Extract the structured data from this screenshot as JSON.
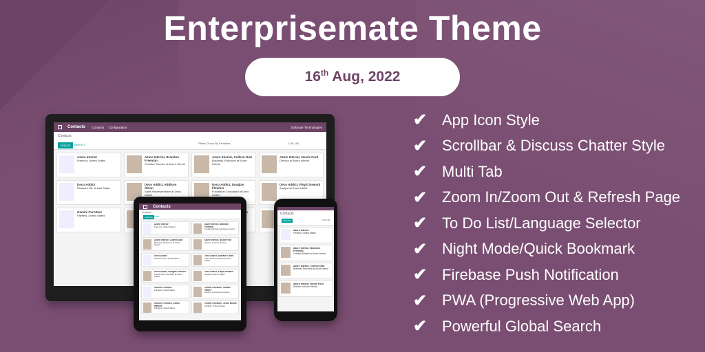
{
  "headline": "Enterprisemate Theme",
  "date": {
    "day": "16",
    "suffix": "th",
    "rest": " Aug, 2022"
  },
  "features": [
    "App Icon Style",
    "Scrollbar & Discuss Chatter Style",
    "Multi Tab",
    "Zoom In/Zoom Out & Refresh Page",
    "To Do List/Language Selector",
    "Night Mode/Quick Bookmark",
    "Firebase Push Notification",
    "PWA (Progressive Web App)",
    "Powerful Global Search"
  ],
  "check_glyph": "✔",
  "colors": {
    "background": "#7a4e72",
    "accent": "#6d4466",
    "button": "#00a09d"
  },
  "mock_app": {
    "app_name": "Contacts",
    "menu": [
      "Contacts",
      "Configuration"
    ],
    "company": "Softmate Technologies",
    "breadcrumb": "Contacts",
    "create_label": "CREATE",
    "import_label": "IMPORT",
    "filters": "Filters  Group By  Favorites",
    "pager": "1-56 / 56",
    "phone_pager": "1-56 / 56",
    "cards": [
      {
        "name": "Azure Interior",
        "line": "Fremont, United States"
      },
      {
        "name": "Azure Interior, Brandon Freeman",
        "line": "Creative Director at Azure Interior"
      },
      {
        "name": "Azure Interior, Colleen Diaz",
        "line": "Business Executive at Azure Interior"
      },
      {
        "name": "Azure Interior, Nicole Ford",
        "line": "Director at Azure Interior"
      },
      {
        "name": "Deco Addict",
        "line": "Pleasant Hill, United States"
      },
      {
        "name": "Deco Addict, Addison Olson",
        "line": "Sales Representative at Deco Addict"
      },
      {
        "name": "Deco Addict, Douglas Fletcher",
        "line": "Functional Consultant at Deco Addict"
      },
      {
        "name": "Deco Addict, Floyd Steward",
        "line": "Analyst at Deco Addict"
      },
      {
        "name": "Gemini Furniture",
        "line": "Fairfield, United States"
      },
      {
        "name": "Gemini Furniture, Soham Palmer",
        "line": "Director at Gemini Furniture"
      },
      {
        "name": "Gemini Furniture, Edwin Hansen",
        "line": "Fairfield, United States"
      },
      {
        "name": "Gemini Furniture, Jesse Brown",
        "line": "Fairfield, United States"
      }
    ]
  }
}
